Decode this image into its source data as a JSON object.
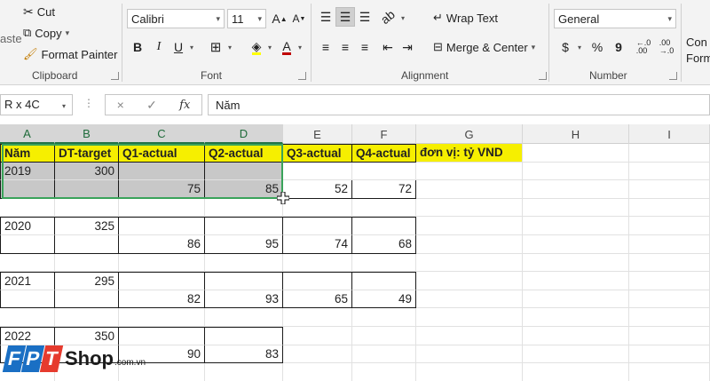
{
  "ribbon": {
    "clipboard": {
      "paste_partial": "aste",
      "cut": "Cut",
      "copy": "Copy",
      "format_painter": "Format Painter",
      "label": "Clipboard"
    },
    "font": {
      "name": "Calibri",
      "size": "11",
      "grow": "A",
      "shrink": "A",
      "bold": "B",
      "italic": "I",
      "underline": "U",
      "font_color_glyph": "A",
      "label": "Font"
    },
    "alignment": {
      "wrap_text": "Wrap Text",
      "merge_center": "Merge & Center",
      "label": "Alignment"
    },
    "number": {
      "format": "General",
      "currency": "$",
      "percent": "%",
      "comma": "9",
      "label": "Number"
    },
    "styles": {
      "cond_line1": "Con",
      "cond_line2": "Form"
    }
  },
  "formula_bar": {
    "name_box": "R x 4C",
    "cancel": "×",
    "enter": "✓",
    "fx": "fx",
    "content": "Năm"
  },
  "columns": [
    "A",
    "B",
    "C",
    "D",
    "E",
    "F",
    "G",
    "H",
    "I"
  ],
  "cells": {
    "r1": [
      "Năm",
      "DT-target",
      "Q1-actual",
      "Q2-actual",
      "Q3-actual",
      "Q4-actual",
      "đơn vị: tỷ VND"
    ],
    "r2": [
      "2019",
      "300"
    ],
    "r3": [
      "75",
      "85",
      "52",
      "72"
    ],
    "r5": [
      "2020",
      "325"
    ],
    "r6": [
      "86",
      "95",
      "74",
      "68"
    ],
    "r8": [
      "2021",
      "295"
    ],
    "r9": [
      "82",
      "93",
      "65",
      "49"
    ],
    "r11": [
      "2022",
      "350"
    ],
    "r12": [
      "90",
      "83"
    ]
  },
  "logo": {
    "letters": [
      "F",
      "P",
      "T"
    ],
    "shop": "Shop",
    "domain": ".com.vn",
    "colors": [
      "#1a6fc4",
      "#1a6fc4",
      "#e63b2e"
    ]
  },
  "colors": {
    "accent": "#217346",
    "header_fill": "#f6ef00",
    "selection_fill": "#c8c8c8"
  }
}
